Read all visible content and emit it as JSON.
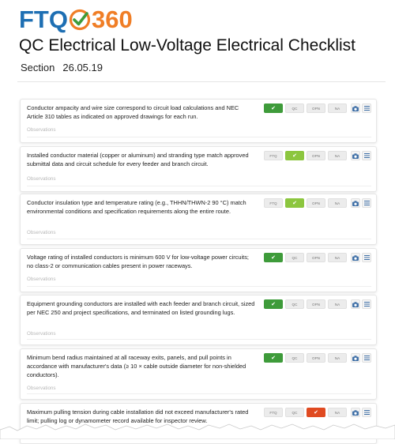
{
  "logo": {
    "left": "FTQ",
    "right": "360"
  },
  "title": "QC Electrical Low-Voltage Electrical Checklist",
  "section": {
    "label": "Section",
    "number": "26.05.19"
  },
  "colors": {
    "green": "#3e9b3a",
    "lime": "#8cc63f",
    "red": "#e04a21",
    "brand_blue": "#1e6fb3",
    "brand_orange": "#f07e26"
  },
  "buttons": {
    "ftq": "FTQ",
    "qc": "QC",
    "opn": "OPN",
    "na": "NA",
    "check": "✔"
  },
  "observations_placeholder": "Observations",
  "icons": {
    "camera": "camera-icon",
    "menu": "menu-icon"
  },
  "items": [
    {
      "question": "Conductor ampacity and wire size correspond to circuit load calculations and NEC Article 310 tables as indicated on approved drawings for each run.",
      "selected": "ftq"
    },
    {
      "question": "Installed conductor material (copper or aluminum) and stranding type match approved submittal data and circuit schedule for every feeder and branch circuit.",
      "selected": "qc"
    },
    {
      "question": "Conductor insulation type and temperature rating (e.g., THHN/THWN-2 90 °C) match environmental conditions and specification requirements along the entire route.",
      "selected": "qc"
    },
    {
      "question": "Voltage rating of installed conductors is minimum 600 V for low-voltage power circuits; no class-2 or communication cables present in power raceways.",
      "selected": "ftq"
    },
    {
      "question": "Equipment grounding conductors are installed with each feeder and branch circuit, sized per NEC 250 and project specifications, and terminated on listed grounding lugs.",
      "selected": "ftq"
    },
    {
      "question": "Minimum bend radius maintained at all raceway exits, panels, and pull points in accordance with manufacturer's data (≥ 10 × cable outside diameter for non-shielded conductors).",
      "selected": "ftq"
    },
    {
      "question": "Maximum pulling tension during cable installation did not exceed manufacturer's rated limit; pulling log or dynamometer record available for inspector review.",
      "selected": "opn"
    }
  ]
}
